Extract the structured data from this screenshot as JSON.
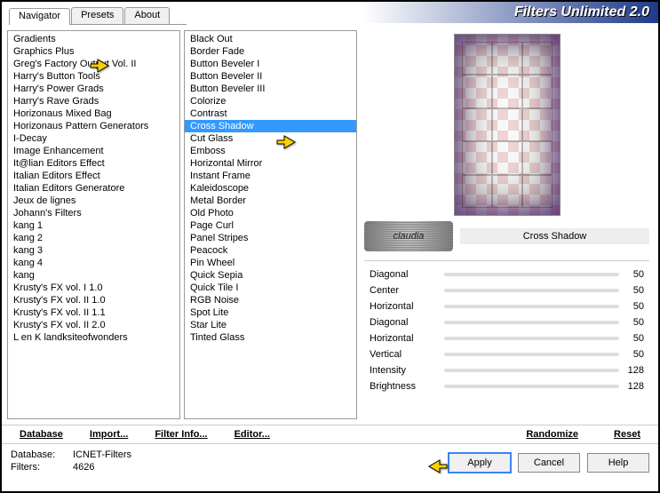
{
  "title": "Filters Unlimited 2.0",
  "tabs": [
    "Navigator",
    "Presets",
    "About"
  ],
  "categories": [
    "Gradients",
    "Graphics Plus",
    "Greg's Factory Output Vol. II",
    "Harry's Button Tools",
    "Harry's Power Grads",
    "Harry's Rave Grads",
    "Horizonaus Mixed Bag",
    "Horizonaus Pattern Generators",
    "I-Decay",
    "Image Enhancement",
    "It@lian Editors Effect",
    "Italian Editors Effect",
    "Italian Editors Generatore",
    "Jeux de lignes",
    "Johann's Filters",
    "kang 1",
    "kang 2",
    "kang 3",
    "kang 4",
    "kang",
    "Krusty's FX vol. I 1.0",
    "Krusty's FX vol. II 1.0",
    "Krusty's FX vol. II 1.1",
    "Krusty's FX vol. II 2.0",
    "L en K landksiteofwonders"
  ],
  "filters": [
    "Black Out",
    "Border Fade",
    "Button Beveler I",
    "Button Beveler II",
    "Button Beveler III",
    "Colorize",
    "Contrast",
    "Cross Shadow",
    "Cut Glass",
    "Emboss",
    "Horizontal Mirror",
    "Instant Frame",
    "Kaleidoscope",
    "Metal Border",
    "Old Photo",
    "Page Curl",
    "Panel Stripes",
    "Peacock",
    "Pin Wheel",
    "Quick Sepia",
    "Quick Tile I",
    "RGB Noise",
    "Spot Lite",
    "Star Lite",
    "Tinted Glass"
  ],
  "selected_filter_index": 7,
  "preview_caption": "Cross Shadow",
  "watermark": "claudia",
  "sliders": [
    {
      "label": "Diagonal",
      "value": 50
    },
    {
      "label": "Center",
      "value": 50
    },
    {
      "label": "Horizontal",
      "value": 50
    },
    {
      "label": "Diagonal",
      "value": 50
    },
    {
      "label": "Horizontal",
      "value": 50
    },
    {
      "label": "Vertical",
      "value": 50
    },
    {
      "label": "Intensity",
      "value": 128
    },
    {
      "label": "Brightness",
      "value": 128
    }
  ],
  "link_buttons": {
    "database": "Database",
    "import": "Import...",
    "filterinfo": "Filter Info...",
    "editor": "Editor...",
    "randomize": "Randomize",
    "reset": "Reset"
  },
  "status": {
    "db_label": "Database:",
    "db_value": "ICNET-Filters",
    "filters_label": "Filters:",
    "filters_value": "4626"
  },
  "buttons": {
    "apply": "Apply",
    "cancel": "Cancel",
    "help": "Help"
  }
}
